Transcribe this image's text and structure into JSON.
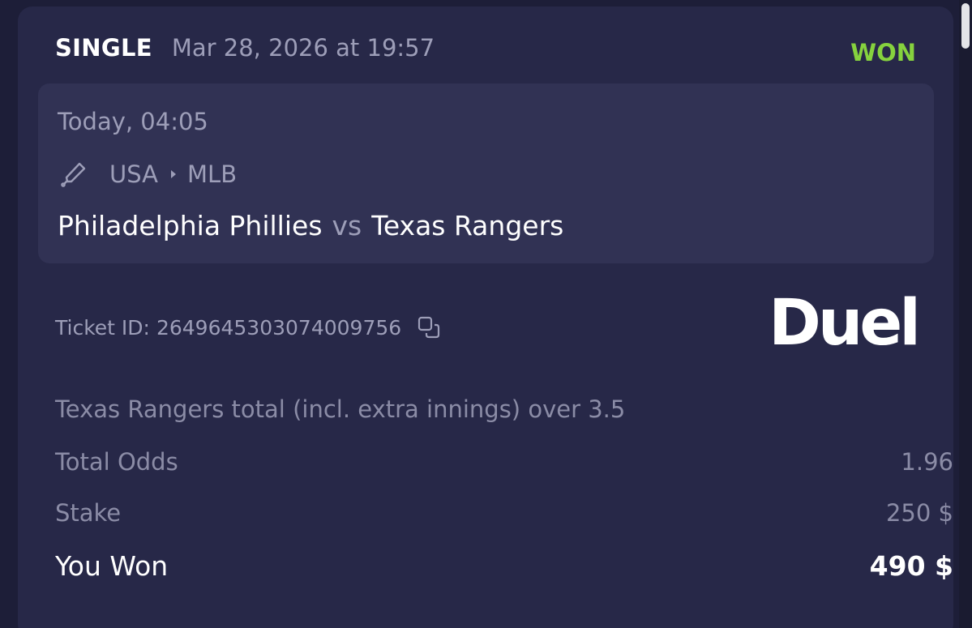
{
  "ticket": {
    "bet_type": "SINGLE",
    "placed_at": "Mar 28, 2026 at 19:57",
    "status": "WON",
    "status_color": "#86d23e"
  },
  "event": {
    "time": "Today, 04:05",
    "sport_icon": "baseball-bat-icon",
    "country": "USA",
    "league": "MLB",
    "home_team": "Philadelphia Phillies",
    "vs": "vs",
    "away_team": "Texas Rangers"
  },
  "ticket_info": {
    "label": "Ticket ID:",
    "id": "2649645303074009756",
    "copy_icon": "copy-icon"
  },
  "brand": {
    "logo_text": "Duel"
  },
  "selection": "Texas Rangers total (incl. extra innings) over 3.5",
  "details": {
    "odds_label": "Total Odds",
    "odds_value": "1.96",
    "stake_label": "Stake",
    "stake_value": "250 $",
    "won_label": "You Won",
    "won_value": "490 $"
  }
}
